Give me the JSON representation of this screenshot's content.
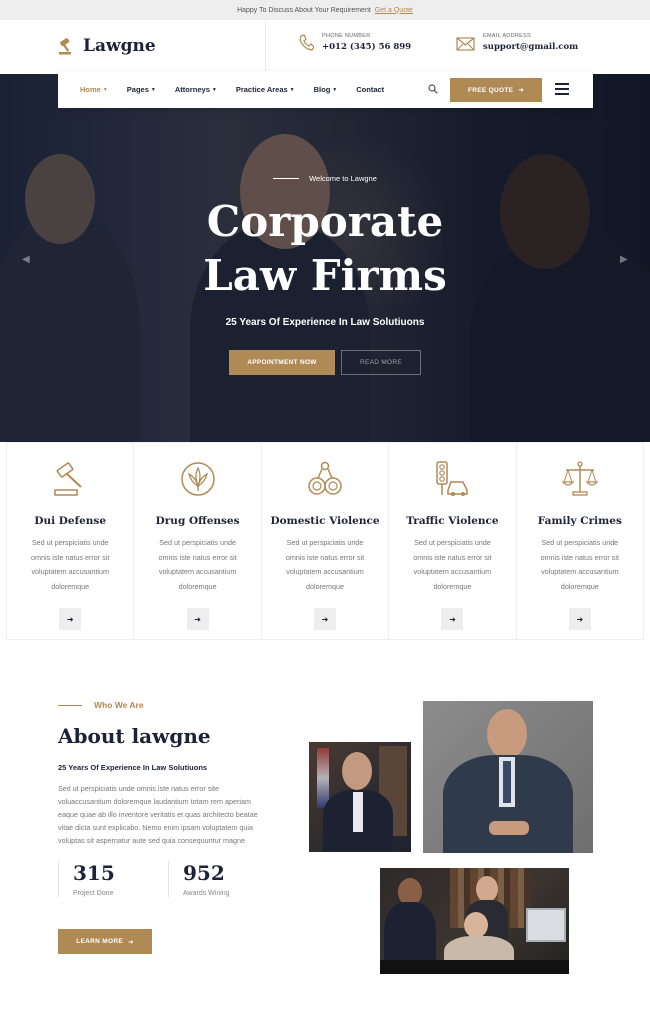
{
  "topbar": {
    "text": "Happy To Discuss About Your Requirement",
    "link": "Get a Quote"
  },
  "header": {
    "logo": "Lawgne",
    "phone_label": "PHONE NUMBER",
    "phone_value": "+012 (345) 56 899",
    "email_label": "EMAIL ADDRESS",
    "email_value": "support@gmail.com"
  },
  "nav": {
    "items": [
      {
        "label": "Home",
        "dropdown": true
      },
      {
        "label": "Pages",
        "dropdown": true
      },
      {
        "label": "Attorneys",
        "dropdown": true
      },
      {
        "label": "Practice Areas",
        "dropdown": true
      },
      {
        "label": "Blog",
        "dropdown": true
      },
      {
        "label": "Contact",
        "dropdown": false
      }
    ],
    "cta": "FREE QUOTE"
  },
  "hero": {
    "welcome": "Welcome to Lawgne",
    "title_line1": "Corporate",
    "title_line2": "Law Firms",
    "subtitle": "25 Years Of Experience In Law Solutiuons",
    "btn_primary": "APPOINTMENT NOW",
    "btn_secondary": "READ MORE"
  },
  "services": [
    {
      "title": "Dui Defense",
      "icon": "gavel-icon",
      "text": "Sed ut perspiciatis unde omnis iste natus error sit voluptatem accusantium doloremque"
    },
    {
      "title": "Drug Offenses",
      "icon": "cannabis-leaf-icon",
      "text": "Sed ut perspiciatis unde omnis iste natus error sit voluptatem accusantium doloremque"
    },
    {
      "title": "Domestic Violence",
      "icon": "handcuffs-icon",
      "text": "Sed ut perspiciatis unde omnis iste natus error sit voluptatem accusantium doloremque"
    },
    {
      "title": "Traffic Violence",
      "icon": "traffic-light-car-icon",
      "text": "Sed ut perspiciatis unde omnis iste natus error sit voluptatem accusantium doloremque"
    },
    {
      "title": "Family Crimes",
      "icon": "scales-icon",
      "text": "Sed ut perspiciatis unde omnis iste natus error sit voluptatem accusantium doloremque"
    }
  ],
  "about": {
    "tag": "Who We Are",
    "title": "About lawgne",
    "subtitle": "25 Years Of Experience In Law Solutiuons",
    "text": "Sed ut perspiciatis unde omnis iste natus error site voluaccusantium doloremque laudantium totam rem aperiam eaque quae ab illo inventore veritatis et quas architecto beatae vitae dicta sunt explicabo. Nemo enim ipsam voluptatem quia voluptas sit aspernatur aute sed quia consequuntur magne",
    "stats": [
      {
        "value": "315",
        "label": "Project Done"
      },
      {
        "value": "952",
        "label": "Awards Wining"
      }
    ],
    "cta": "LEARN MORE"
  },
  "colors": {
    "accent": "#b08a54",
    "navy": "#1c2237"
  }
}
